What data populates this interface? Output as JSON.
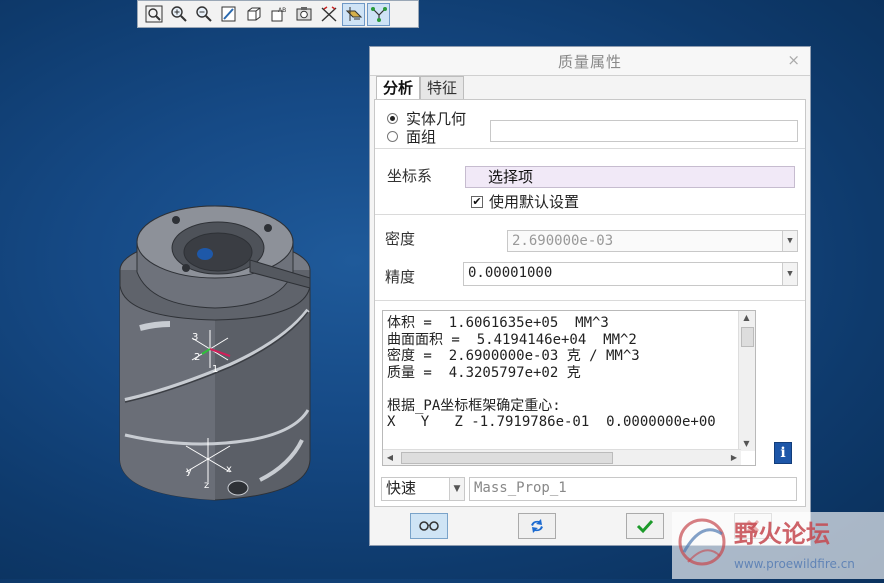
{
  "toolbar": {
    "buttons": [
      {
        "icon": "zoom-fit-icon"
      },
      {
        "icon": "zoom-in-icon"
      },
      {
        "icon": "zoom-out-icon"
      },
      {
        "icon": "repaint-icon"
      },
      {
        "icon": "view-orient-icon"
      },
      {
        "icon": "saved-views-icon",
        "text": "AB"
      },
      {
        "icon": "display-style-icon"
      },
      {
        "icon": "datum-axes-icon"
      },
      {
        "icon": "datum-planes-icon",
        "active": true
      },
      {
        "icon": "datum-points-icon",
        "active": true
      }
    ]
  },
  "dialog": {
    "title": "质量属性",
    "close": "×",
    "tabs": [
      {
        "label": "分析",
        "active": true
      },
      {
        "label": "特征",
        "active": false
      }
    ],
    "geometry": {
      "solid_label": "实体几何",
      "quilt_label": "面组",
      "quilt_value": ""
    },
    "csys": {
      "label": "坐标系",
      "select_value": "选择项",
      "use_default_label": "使用默认设置",
      "use_default_checked": true,
      "check_mark": "✔"
    },
    "density": {
      "label": "密度",
      "value": "2.690000e-03"
    },
    "accuracy": {
      "label": "精度",
      "value": "0.00001000"
    },
    "results_lines": [
      "体积 =  1.6061635e+05  MM^3",
      "曲面面积 =  5.4194146e+04  MM^2",
      "密度 =  2.6900000e-03 克 / MM^3",
      "质量 =  4.3205797e+02 克",
      "",
      "根据_PA坐标框架确定重心:",
      "X   Y   Z -1.7919786e-01  0.0000000e+00"
    ],
    "info_icon": "i",
    "mode": {
      "value": "快速",
      "name_value": "Mass_Prop_1"
    }
  },
  "model": {
    "axes_top": {
      "x": "1",
      "y": "2",
      "z": "3"
    },
    "axes_bottom": {
      "x": "x",
      "y": "y",
      "z": "z"
    }
  },
  "watermark": {
    "text": "野火论坛",
    "url": "www.proewildfire.cn"
  }
}
